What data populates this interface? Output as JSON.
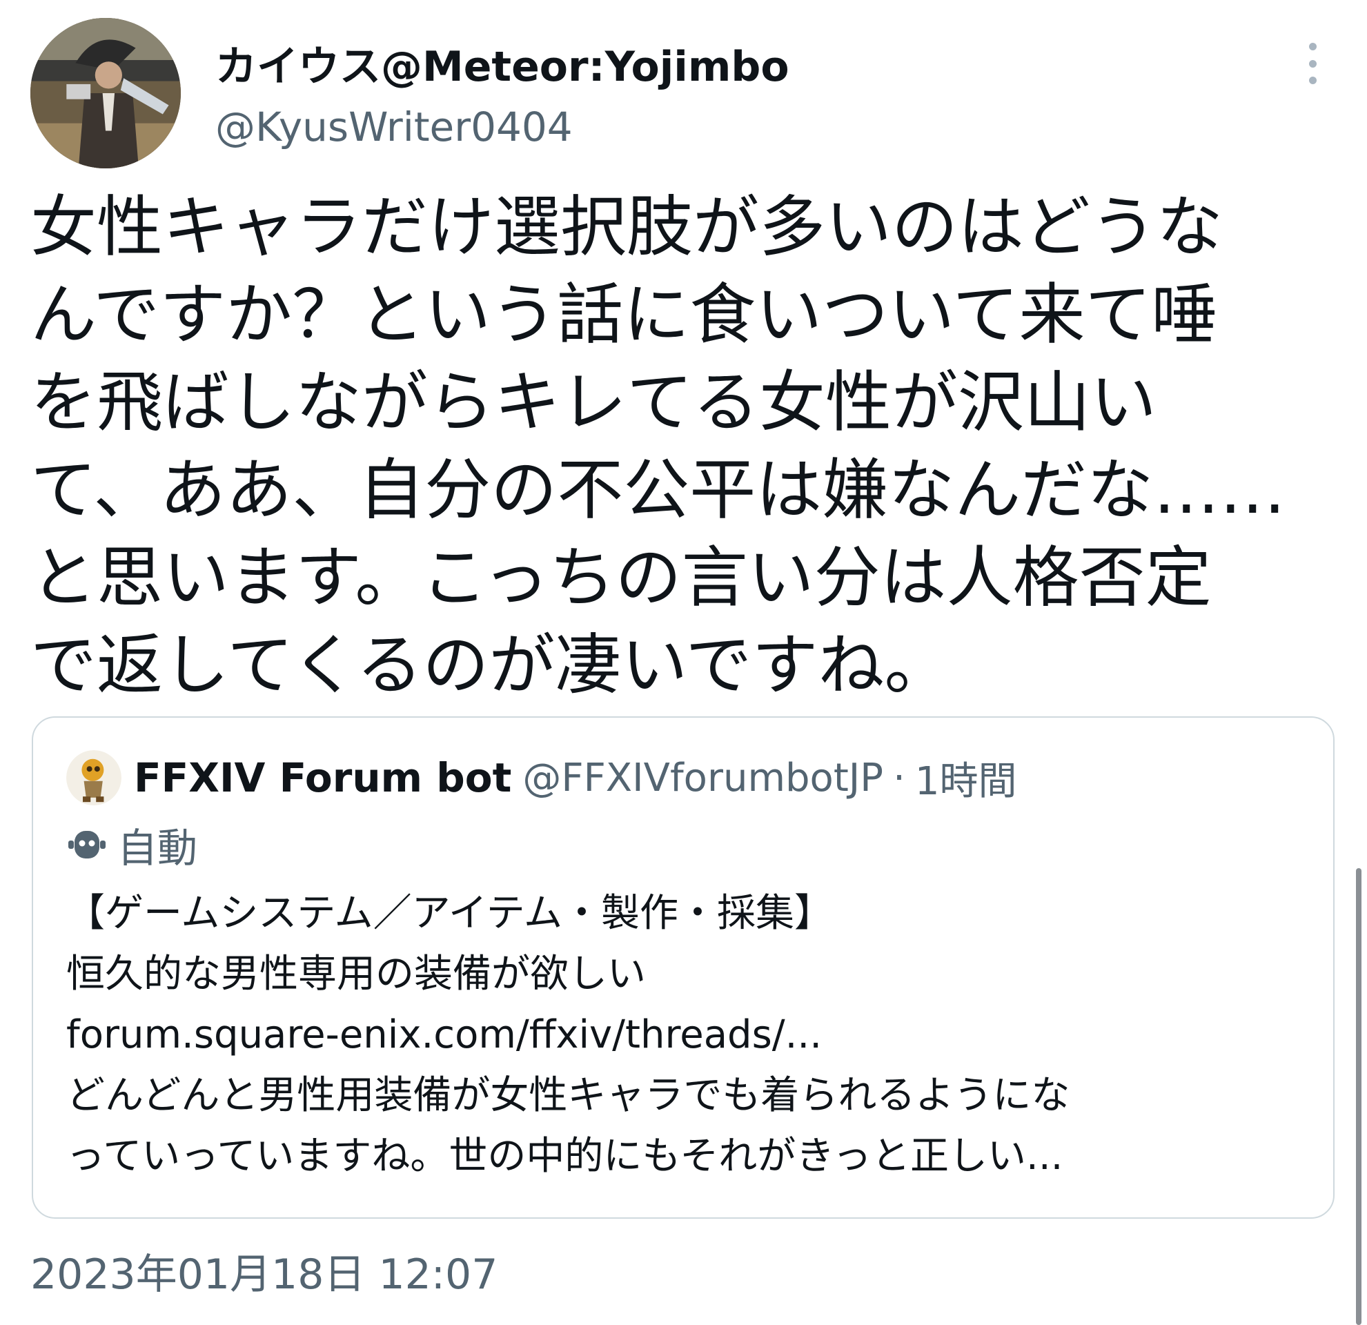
{
  "author": {
    "display_name": "カイウス@Meteor:Yojimbo",
    "handle": "@KyusWriter0404"
  },
  "tweet": {
    "text_lines": [
      "女性キャラだけ選択肢が多いのはどうな",
      "んですか？という話に食いついて来て唾",
      "を飛ばしながらキレてる女性が沢山い",
      "て、ああ、自分の不公平は嫌なんだな……",
      "と思います。こっちの言い分は人格否定",
      "で返してくるのが凄いですね。"
    ],
    "timestamp": "2023年01月18日 12:07"
  },
  "quote": {
    "name": "FFXIV Forum bot",
    "handle": "@FFXIVforumbotJP",
    "separator": "·",
    "time": "1時間",
    "auto_label": "自動",
    "body_lines": [
      "【ゲームシステム／アイテム・製作・採集】",
      "恒久的な男性専用の装備が欲しい",
      "forum.square-enix.com/ffxiv/threads/...",
      "どんどんと男性用装備が女性キャラでも着られるようにな",
      "っていっていますね。世の中的にもそれがきっと正しい..."
    ]
  },
  "icons": {
    "more": "more-vertical-icon",
    "bot": "bot-icon"
  },
  "colors": {
    "text": "#0f1419",
    "secondary": "#536471",
    "border": "#cfd9de"
  }
}
